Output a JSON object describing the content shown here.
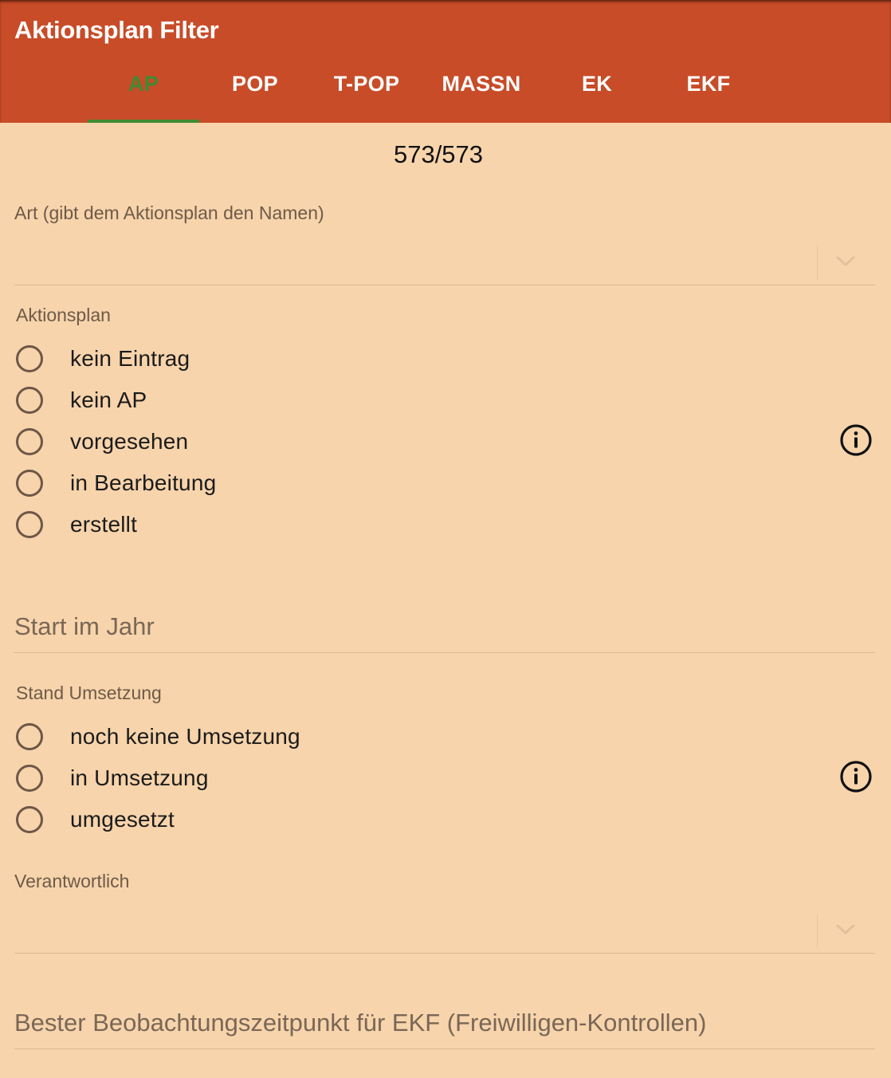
{
  "header": {
    "title": "Aktionsplan Filter",
    "tabs": [
      {
        "label": "AP",
        "active": true
      },
      {
        "label": "POP",
        "active": false
      },
      {
        "label": "T-POP",
        "active": false
      },
      {
        "label": "MASSN",
        "active": false
      },
      {
        "label": "EK",
        "active": false
      },
      {
        "label": "EKF",
        "active": false
      }
    ]
  },
  "count": "573/573",
  "fields": {
    "art": {
      "label": "Art (gibt dem Aktionsplan den Namen)",
      "value": ""
    },
    "aktionsplan": {
      "label": "Aktionsplan",
      "options": [
        "kein Eintrag",
        "kein AP",
        "vorgesehen",
        "in Bearbeitung",
        "erstellt"
      ]
    },
    "start_im_jahr": {
      "label": "Start im Jahr",
      "value": ""
    },
    "stand_umsetzung": {
      "label": "Stand Umsetzung",
      "options": [
        "noch keine Umsetzung",
        "in Umsetzung",
        "umgesetzt"
      ]
    },
    "verantwortlich": {
      "label": "Verantwortlich",
      "value": ""
    },
    "bester_beobachtungszeitpunkt": {
      "label": "Bester Beobachtungszeitpunkt für EKF (Freiwilligen-Kontrollen)",
      "value": ""
    }
  },
  "colors": {
    "appbar": "#c84c28",
    "background": "#f7d4ab",
    "active_tab": "#3f8a32"
  },
  "icons": {
    "info": "info-circle-icon",
    "dropdown": "chevron-down-icon"
  }
}
